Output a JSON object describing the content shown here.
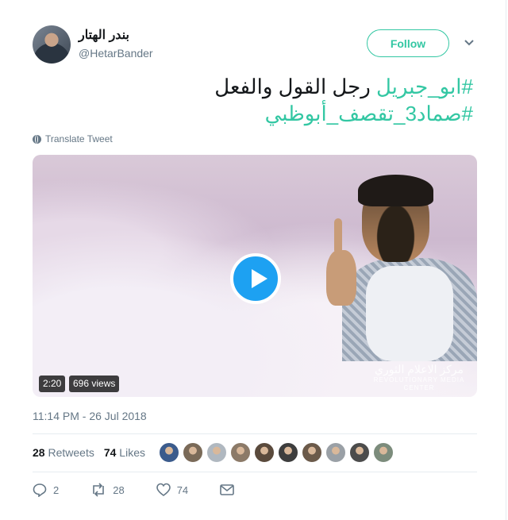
{
  "author": {
    "name": "بندر الهتار",
    "handle": "@HetarBander"
  },
  "follow_label": "Follow",
  "tweet": {
    "line1_hashtag": "#ابو_جبريل",
    "line1_text": " رجل القول والفعل",
    "line2_hashtag": "#صماد3_تقصف_أبوظبي"
  },
  "translate_label": "Translate Tweet",
  "video": {
    "duration": "2:20",
    "views": "696 views",
    "watermark_ar": "مركز الاعلام الثوري",
    "watermark_en_1": "REVOLUTIONARY MEDIA",
    "watermark_en_2": "CENTER"
  },
  "timestamp": "11:14 PM - 26 Jul 2018",
  "stats": {
    "retweets_count": "28",
    "retweets_label": "Retweets",
    "likes_count": "74",
    "likes_label": "Likes"
  },
  "liker_avatar_colors": [
    "#3b5b8c",
    "#7a6a58",
    "#b0b8c0",
    "#8c7a68",
    "#5a4a3c",
    "#3d3d3d",
    "#6b5a4a",
    "#9aa0a6",
    "#4c4c4c",
    "#7c8c7c"
  ],
  "actions": {
    "reply_count": "2",
    "retweet_count": "28",
    "like_count": "74"
  },
  "colors": {
    "accent": "#33c7a3",
    "play": "#1da1f2",
    "muted": "#657786"
  }
}
